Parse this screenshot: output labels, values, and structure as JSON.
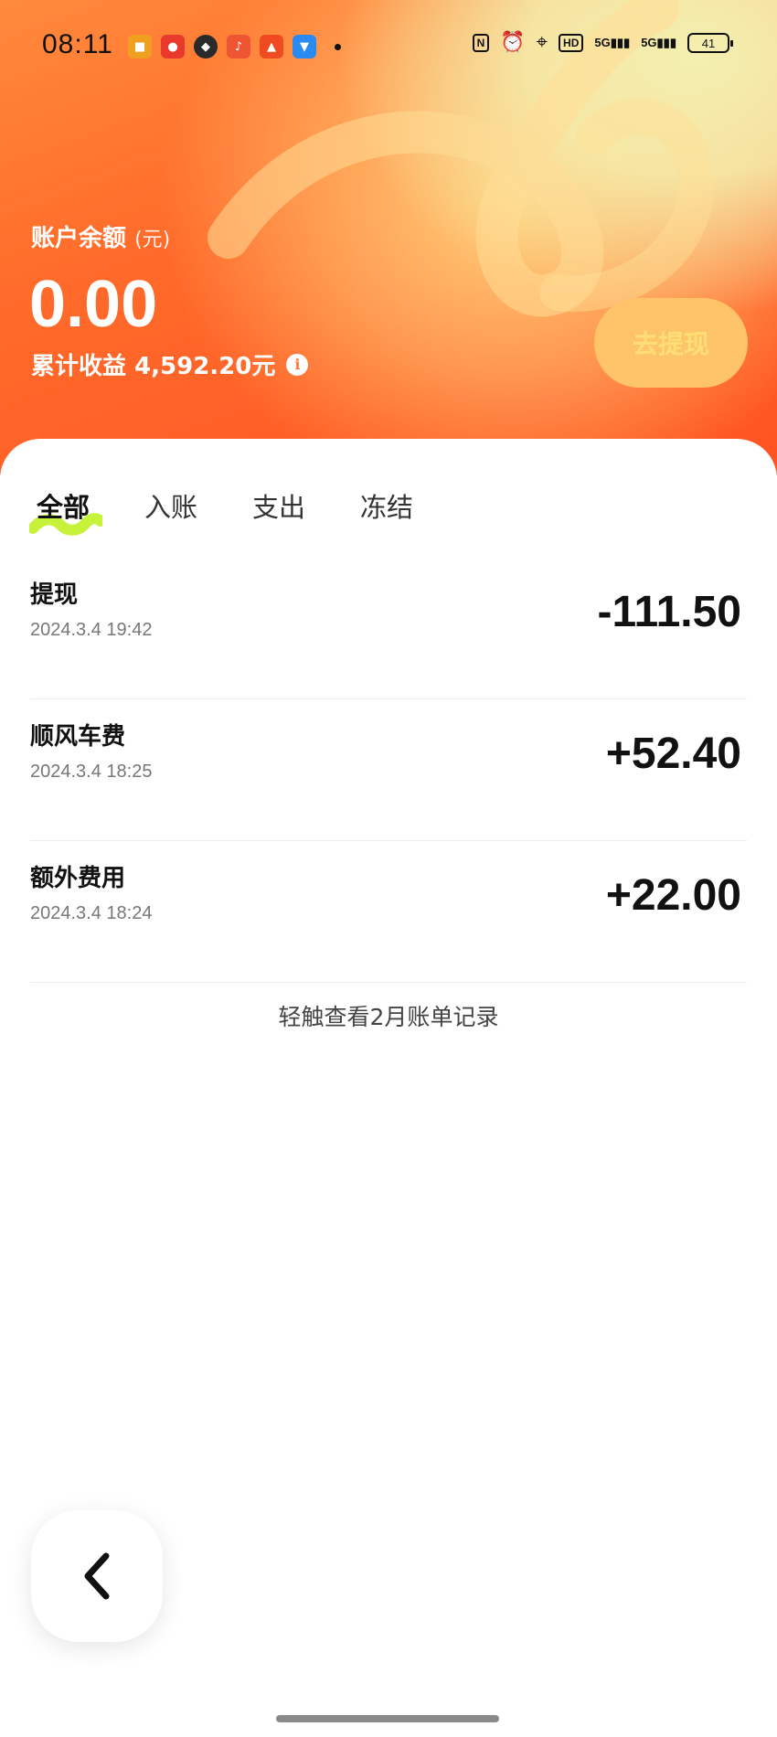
{
  "status_bar": {
    "time": "08:11",
    "battery": "41",
    "right_icons": [
      "nfc-icon",
      "alarm-icon",
      "location-icon",
      "hd-icon",
      "signal-5g-icon",
      "signal-5g-icon"
    ],
    "hd_label": "HD",
    "signal_label": "5G",
    "app_icons": [
      {
        "name": "app-notification-1",
        "color": "#f0a020"
      },
      {
        "name": "app-notification-2",
        "color": "#e8392c"
      },
      {
        "name": "app-notification-3",
        "color": "#2a2a2a"
      },
      {
        "name": "app-notification-4",
        "color": "#ee5533"
      },
      {
        "name": "app-notification-5",
        "color": "#f04a20"
      },
      {
        "name": "app-notification-6",
        "color": "#2a8af0"
      }
    ]
  },
  "account": {
    "balance_label": "账户余额",
    "balance_unit": "(元)",
    "balance": "0.00",
    "earnings_text": "累计收益 4,592.20元",
    "withdraw_label": "去提现"
  },
  "tabs": [
    {
      "label": "全部",
      "active": true
    },
    {
      "label": "入账",
      "active": false
    },
    {
      "label": "支出",
      "active": false
    },
    {
      "label": "冻结",
      "active": false
    }
  ],
  "transactions": [
    {
      "title": "提现",
      "time": "2024.3.4 19:42",
      "amount": "-111.50"
    },
    {
      "title": "顺风车费",
      "time": "2024.3.4 18:25",
      "amount": "+52.40"
    },
    {
      "title": "额外费用",
      "time": "2024.3.4 18:24",
      "amount": "+22.00"
    }
  ],
  "more_link": "轻触查看2月账单记录",
  "colors": {
    "accent_orange": "#ff6b2a",
    "tab_highlight": "#c6f23a",
    "withdraw_bg": "#ffc46a",
    "withdraw_text": "#ffdf75"
  }
}
